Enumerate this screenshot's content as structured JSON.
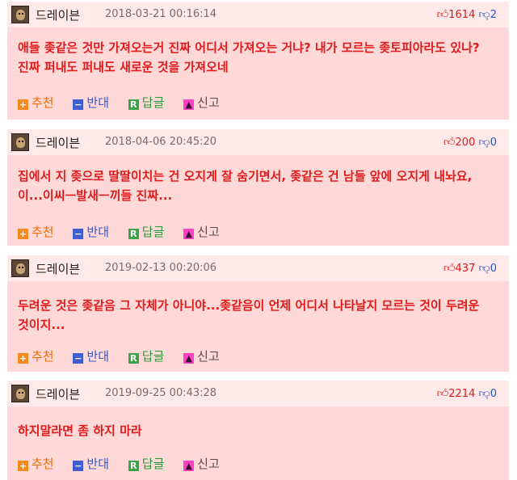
{
  "comments": [
    {
      "nickname": "드레이븐",
      "date": "2018-03-21 00:16:14",
      "upvotes": "1614",
      "downvotes": "2",
      "text": "애들 좆같은 것만 가져오는거 진짜 어디서 가져오는 거냐? 내가 모르는 좆토피아라도 있나? 진짜 퍼내도 퍼내도 새로운 것을 가져오네"
    },
    {
      "nickname": "드레이븐",
      "date": "2018-04-06 20:45:20",
      "upvotes": "200",
      "downvotes": "0",
      "text": "집에서 지 좆으로 딸딸이치는 건 오지게 잘 숨기면서, 좆같은 건 남들 앞에 오지게 내놔요, 이...이씨ㅡ발새ㅡ끼들 진짜..."
    },
    {
      "nickname": "드레이븐",
      "date": "2019-02-13 00:20:06",
      "upvotes": "437",
      "downvotes": "0",
      "text": "두려운 것은 좆같음 그 자체가 아니야...좆같음이 언제 어디서 나타날지 모르는 것이 두려운 것이지..."
    },
    {
      "nickname": "드레이븐",
      "date": "2019-09-25 00:43:28",
      "upvotes": "2214",
      "downvotes": "0",
      "text": "하지말라면 좀 하지 마라"
    }
  ],
  "actions": {
    "recommend_icon": "+",
    "recommend_label": "추천",
    "oppose_icon": "−",
    "oppose_label": "반대",
    "reply_icon": "R",
    "reply_label": "답글",
    "report_icon": "▲",
    "report_label": "신고"
  },
  "icons": {
    "upvote": "thumbs-up-icon",
    "downvote": "thumbs-down-icon",
    "avatar": "draven-avatar"
  },
  "colors": {
    "card_background": "#ffd8d8",
    "header_background": "#ffe9e9",
    "comment_text": "#e11b1b",
    "upvote": "#e01919",
    "downvote": "#1f55c9"
  }
}
